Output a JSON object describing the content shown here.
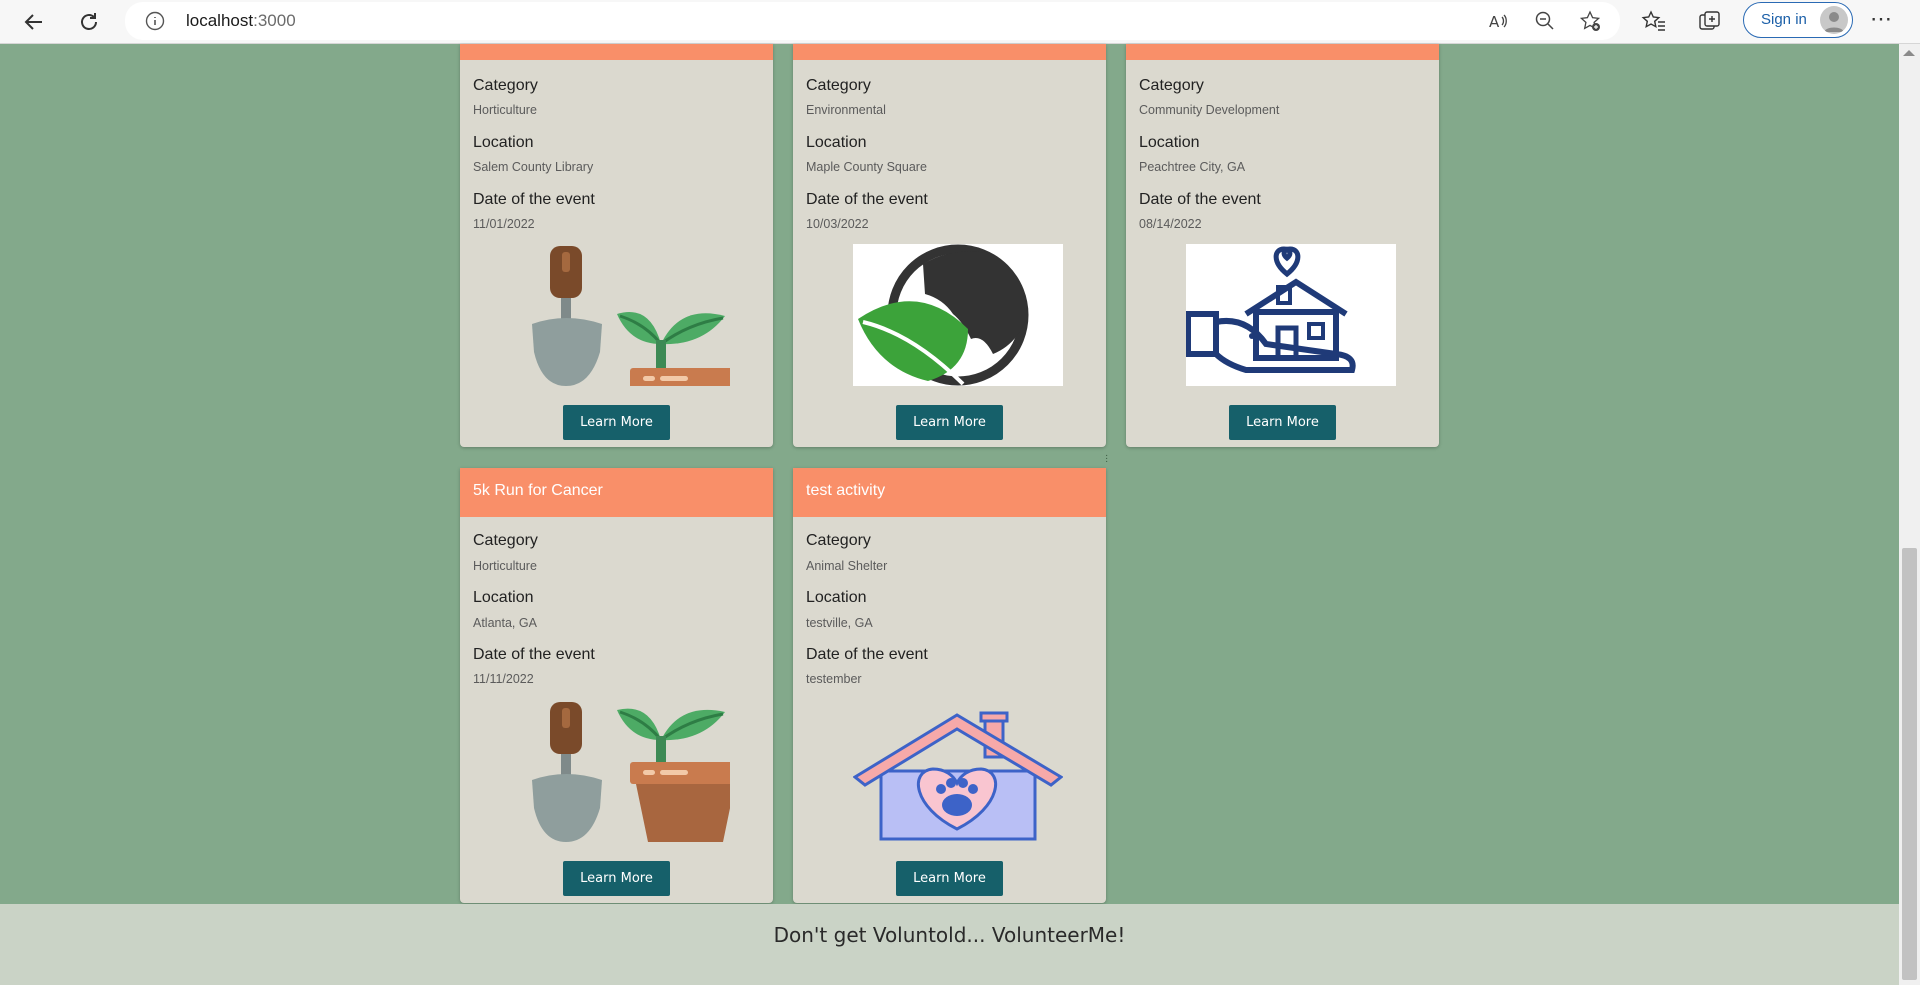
{
  "browser": {
    "url_host": "localhost",
    "url_port": ":3000",
    "signin_label": "Sign in"
  },
  "labels": {
    "category": "Category",
    "location": "Location",
    "date": "Date of the event",
    "learn_more": "Learn More"
  },
  "cards_row1": [
    {
      "category": "Horticulture",
      "location": "Salem County Library",
      "date": "11/01/2022",
      "icon": "gardening-icon"
    },
    {
      "category": "Environmental",
      "location": "Maple County Square",
      "date": "10/03/2022",
      "icon": "earth-leaf-icon"
    },
    {
      "category": "Community Development",
      "location": "Peachtree City, GA",
      "date": "08/14/2022",
      "icon": "hand-house-icon"
    }
  ],
  "cards_row2": [
    {
      "title": "5k Run for Cancer",
      "category": "Horticulture",
      "location": "Atlanta, GA",
      "date": "11/11/2022",
      "icon": "gardening-icon"
    },
    {
      "title": "test activity",
      "category": "Animal Shelter",
      "location": "testville, GA",
      "date": "testember",
      "icon": "pet-house-icon"
    }
  ],
  "footer": {
    "tagline": "Don't get Voluntold... VolunteerMe!"
  },
  "colors": {
    "page_bg": "#83a98b",
    "card_header": "#f98f69",
    "card_body": "#dbd9cf",
    "button": "#16606a",
    "footer_bg": "#cad3c6"
  }
}
